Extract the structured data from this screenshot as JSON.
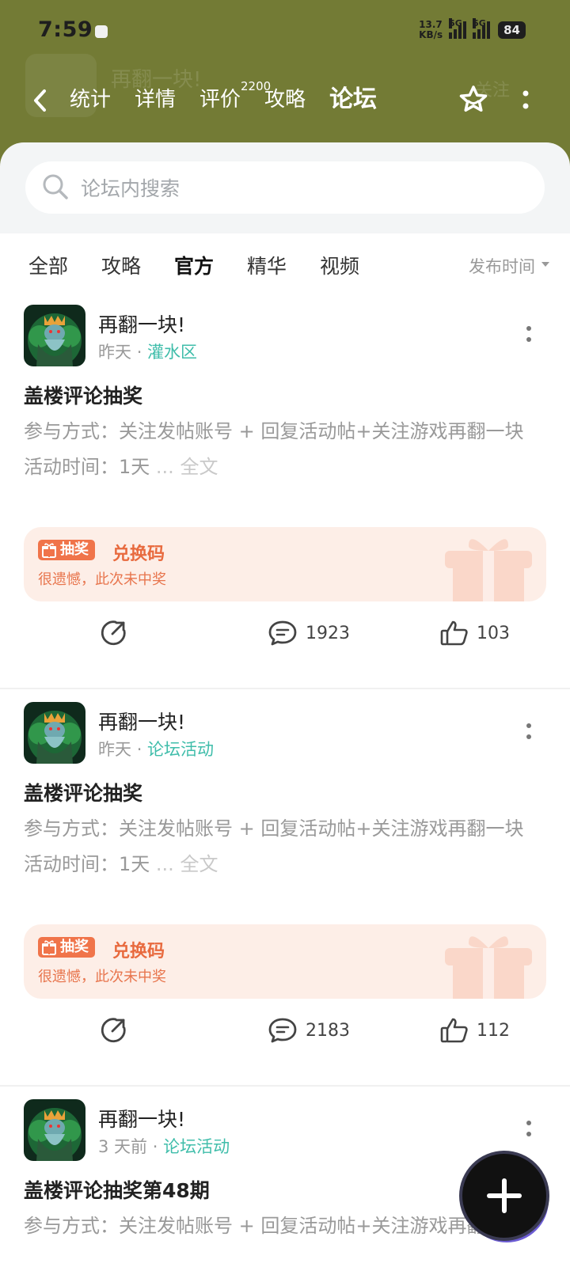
{
  "status_bar": {
    "time": "7:59",
    "net_speed_value": "13.7",
    "net_speed_unit": "KB/s",
    "signal_1": "5G",
    "signal_2": "5G",
    "battery": "84"
  },
  "app_bar": {
    "ghost_title": "再翻一块!",
    "ghost_follow": "关注",
    "tabs": [
      {
        "label": "统计"
      },
      {
        "label": "详情"
      },
      {
        "label": "评价",
        "badge": "2200"
      },
      {
        "label": "攻略"
      },
      {
        "label": "论坛"
      }
    ],
    "active_tab": "论坛"
  },
  "search": {
    "placeholder": "论坛内搜索"
  },
  "filters": {
    "tabs": [
      "全部",
      "攻略",
      "官方",
      "精华",
      "视频"
    ],
    "active": "官方",
    "sort_label": "发布时间"
  },
  "posts": [
    {
      "author": "再翻一块!",
      "time": "昨天",
      "category": "灌水区",
      "title": "盖楼评论抽奖",
      "excerpt_line1": "参与方式：关注发帖账号 + 回复活动帖+关注游戏再翻一块",
      "excerpt_line2": "活动时间：1天",
      "ellipsis": "...",
      "more_label": "全文",
      "lottery_tag": "抽奖",
      "lottery_label": "兑换码",
      "lottery_status": "很遗憾，此次未中奖",
      "comments": "1923",
      "likes": "103"
    },
    {
      "author": "再翻一块!",
      "time": "昨天",
      "category": "论坛活动",
      "title": "盖楼评论抽奖",
      "excerpt_line1": "参与方式：关注发帖账号 + 回复活动帖+关注游戏再翻一块",
      "excerpt_line2": "活动时间：1天",
      "ellipsis": "...",
      "more_label": "全文",
      "lottery_tag": "抽奖",
      "lottery_label": "兑换码",
      "lottery_status": "很遗憾，此次未中奖",
      "comments": "2183",
      "likes": "112"
    },
    {
      "author": "再翻一块!",
      "time": "3 天前",
      "category": "论坛活动",
      "title": "盖楼评论抽奖第48期",
      "excerpt_line1": "参与方式：关注发帖账号 + 回复活动帖+关注游戏再翻一块"
    }
  ],
  "icons": {
    "share": "share-icon",
    "comment": "comment-icon",
    "like": "thumbs-up-icon",
    "more": "more-vertical-icon",
    "star": "star-icon",
    "back": "back-arrow-icon",
    "search": "search-icon",
    "gift": "gift-icon",
    "fab": "plus-icon"
  },
  "colors": {
    "header_bg": "#737b35",
    "accent": "#4fd0b8",
    "category": "#3fbdaa",
    "lottery_bg": "#fdeee7",
    "lottery_text": "#e86a3e"
  }
}
